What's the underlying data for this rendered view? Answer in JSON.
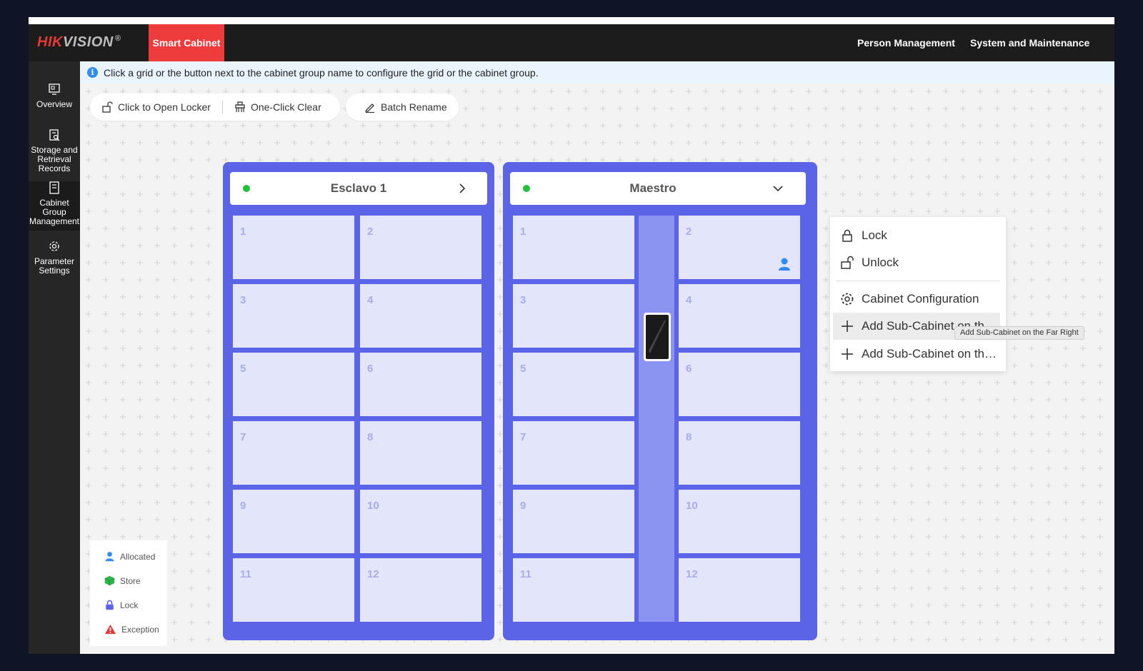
{
  "header": {
    "logo_main": "HIK",
    "logo_sub": "VISION",
    "logo_reg": "®",
    "active_tab": "Smart Cabinet",
    "nav_person": "Person Management",
    "nav_system": "System and Maintenance"
  },
  "sidebar": {
    "items": [
      {
        "label": "Overview",
        "icon": "monitor-icon"
      },
      {
        "label": "Storage and Retrieval Records",
        "icon": "clipboard-search-icon"
      },
      {
        "label": "Cabinet Group Management",
        "icon": "document-icon"
      },
      {
        "label": "Parameter Settings",
        "icon": "gear-icon"
      }
    ]
  },
  "info": {
    "text": "Click a grid or the button next to the cabinet group name to configure the grid or the cabinet group."
  },
  "toolbar": {
    "open_locker": "Click to Open Locker",
    "one_click_clear": "One-Click Clear",
    "batch_rename": "Batch Rename"
  },
  "cabinets": [
    {
      "name": "Esclavo 1",
      "status_color": "#21c03a",
      "toggle_icon": "chevron-right-icon",
      "cells": [
        "1",
        "2",
        "3",
        "4",
        "5",
        "6",
        "7",
        "8",
        "9",
        "10",
        "11",
        "12"
      ]
    },
    {
      "name": "Maestro",
      "status_color": "#21c03a",
      "toggle_icon": "chevron-down-icon",
      "cells": [
        "1",
        "2",
        "3",
        "4",
        "5",
        "6",
        "7",
        "8",
        "9",
        "10",
        "11",
        "12"
      ],
      "allocated_cell": "2"
    }
  ],
  "menu": {
    "lock": "Lock",
    "unlock": "Unlock",
    "cabinet_configuration": "Cabinet Configuration",
    "add_left": "Add Sub-Cabinet on th…",
    "add_right": "Add Sub-Cabinet on th…",
    "tooltip": "Add Sub-Cabinet on the Far Right"
  },
  "legend": {
    "allocated": "Allocated",
    "store": "Store",
    "lock": "Lock",
    "exception": "Exception"
  },
  "colors": {
    "brand_red": "#ef3b3b",
    "cabinet_blue": "#5b63e6",
    "status_green": "#21c03a",
    "info_blue": "#2f8cf0"
  }
}
